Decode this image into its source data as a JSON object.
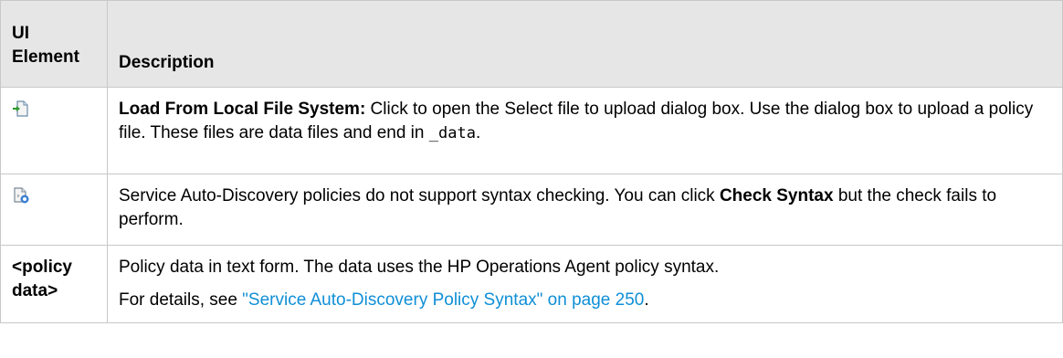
{
  "header": {
    "col1": "UI Element",
    "col1_line1": "UI",
    "col1_line2": "Element",
    "col2": "Description"
  },
  "rows": [
    {
      "icon": "load-from-file-icon",
      "bold": "Load From Local File System:",
      "text": " Click to open the Select file to upload dialog box. Use the dialog box to upload a policy file. These files are data files and end in ",
      "code": "_data",
      "tail": "."
    },
    {
      "icon": "check-syntax-icon",
      "text1": "Service Auto-Discovery policies do not support syntax checking. You can click ",
      "bold": "Check Syntax",
      "text2": " but the check fails to perform."
    },
    {
      "element_line1": "<policy",
      "element_line2": "data>",
      "para1": "Policy data in text form. The data uses the HP Operations Agent policy syntax.",
      "para2_prefix": "For details, see ",
      "link": "\"Service Auto-Discovery Policy Syntax\" on page 250",
      "para2_suffix": "."
    }
  ],
  "colors": {
    "header_bg": "#e6e6e6",
    "border": "#c8c8c8",
    "link": "#0f8fd6"
  }
}
